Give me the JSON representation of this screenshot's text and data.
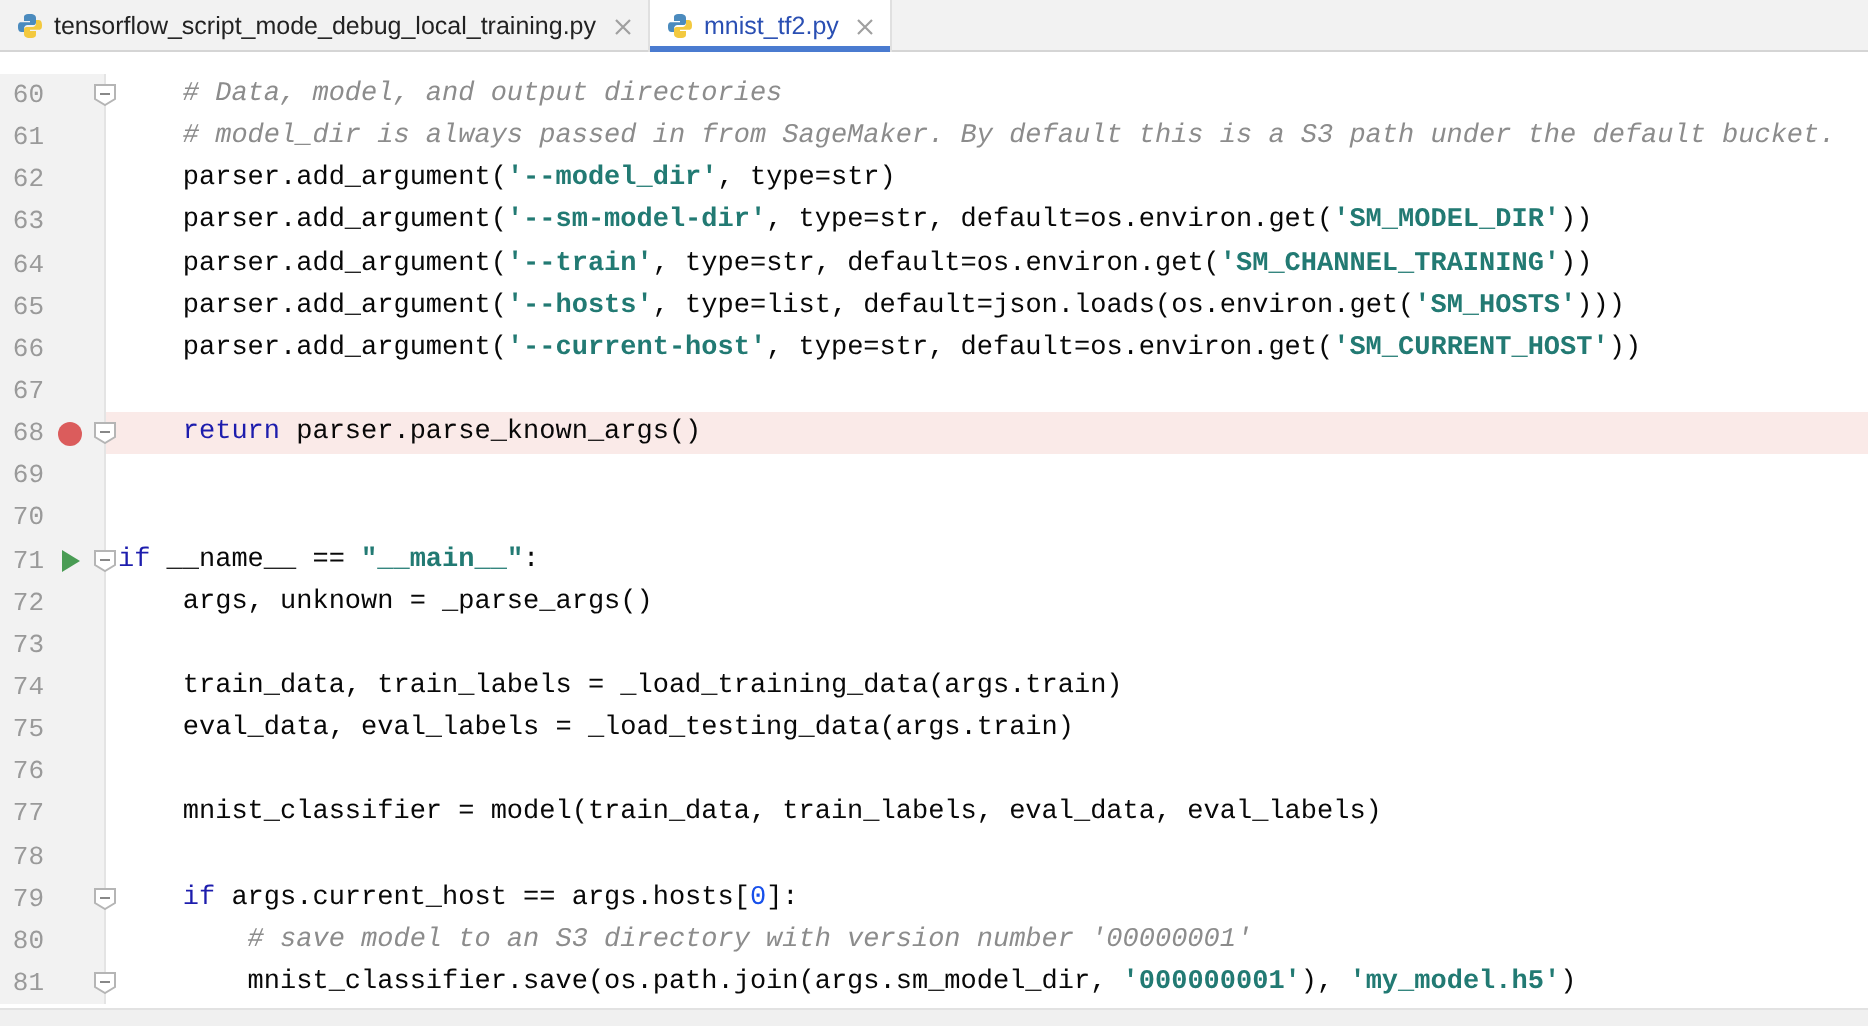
{
  "tabs": [
    {
      "label": "tensorflow_script_mode_debug_local_training.py",
      "selected": false
    },
    {
      "label": "mnist_tf2.py",
      "selected": true
    }
  ],
  "editor": {
    "lines": [
      {
        "number": "60",
        "fold": true,
        "tokens": [
          {
            "kind": "comment",
            "text": "    # Data, model, and output directories"
          }
        ]
      },
      {
        "number": "61",
        "tokens": [
          {
            "kind": "comment",
            "text": "    # model_dir is always passed in from SageMaker. By default this is a S3 path under the default bucket."
          }
        ]
      },
      {
        "number": "62",
        "tokens": [
          {
            "kind": "plain",
            "text": "    parser.add_argument("
          },
          {
            "kind": "string",
            "text": "'--model_dir'"
          },
          {
            "kind": "plain",
            "text": ", type=str)"
          }
        ]
      },
      {
        "number": "63",
        "tokens": [
          {
            "kind": "plain",
            "text": "    parser.add_argument("
          },
          {
            "kind": "string",
            "text": "'--sm-model-dir'"
          },
          {
            "kind": "plain",
            "text": ", type=str, default=os.environ.get("
          },
          {
            "kind": "string",
            "text": "'SM_MODEL_DIR'"
          },
          {
            "kind": "plain",
            "text": "))"
          }
        ]
      },
      {
        "number": "64",
        "tokens": [
          {
            "kind": "plain",
            "text": "    parser.add_argument("
          },
          {
            "kind": "string",
            "text": "'--train'"
          },
          {
            "kind": "plain",
            "text": ", type=str, default=os.environ.get("
          },
          {
            "kind": "string",
            "text": "'SM_CHANNEL_TRAINING'"
          },
          {
            "kind": "plain",
            "text": "))"
          }
        ]
      },
      {
        "number": "65",
        "tokens": [
          {
            "kind": "plain",
            "text": "    parser.add_argument("
          },
          {
            "kind": "string",
            "text": "'--hosts'"
          },
          {
            "kind": "plain",
            "text": ", type=list, default=json.loads(os.environ.get("
          },
          {
            "kind": "string",
            "text": "'SM_HOSTS'"
          },
          {
            "kind": "plain",
            "text": ")))"
          }
        ]
      },
      {
        "number": "66",
        "tokens": [
          {
            "kind": "plain",
            "text": "    parser.add_argument("
          },
          {
            "kind": "string",
            "text": "'--current-host'"
          },
          {
            "kind": "plain",
            "text": ", type=str, default=os.environ.get("
          },
          {
            "kind": "string",
            "text": "'SM_CURRENT_HOST'"
          },
          {
            "kind": "plain",
            "text": "))"
          }
        ]
      },
      {
        "number": "67"
      },
      {
        "number": "68",
        "fold": true,
        "breakpoint": true,
        "highlighted": true,
        "tokens": [
          {
            "kind": "keyword",
            "text": "    return"
          },
          {
            "kind": "plain",
            "text": " parser.parse_known_args()"
          }
        ]
      },
      {
        "number": "69"
      },
      {
        "number": "70"
      },
      {
        "number": "71",
        "fold": true,
        "run": true,
        "tokens": [
          {
            "kind": "keyword",
            "text": "if"
          },
          {
            "kind": "plain",
            "text": " __name__ == "
          },
          {
            "kind": "string",
            "text": "\"__main__\""
          },
          {
            "kind": "plain",
            "text": ":"
          }
        ]
      },
      {
        "number": "72",
        "tokens": [
          {
            "kind": "plain",
            "text": "    args, unknown = _parse_args()"
          }
        ]
      },
      {
        "number": "73"
      },
      {
        "number": "74",
        "tokens": [
          {
            "kind": "plain",
            "text": "    train_data, train_labels = _load_training_data(args.train)"
          }
        ]
      },
      {
        "number": "75",
        "tokens": [
          {
            "kind": "plain",
            "text": "    eval_data, eval_labels = _load_testing_data(args.train)"
          }
        ]
      },
      {
        "number": "76"
      },
      {
        "number": "77",
        "tokens": [
          {
            "kind": "plain",
            "text": "    mnist_classifier = model(train_data, train_labels, eval_data, eval_labels)"
          }
        ]
      },
      {
        "number": "78"
      },
      {
        "number": "79",
        "fold": true,
        "tokens": [
          {
            "kind": "keyword",
            "text": "    if"
          },
          {
            "kind": "plain",
            "text": " args.current_host == args.hosts["
          },
          {
            "kind": "number",
            "text": "0"
          },
          {
            "kind": "plain",
            "text": "]:"
          }
        ]
      },
      {
        "number": "80",
        "tokens": [
          {
            "kind": "comment",
            "text": "        # save model to an S3 directory with version number '00000001'"
          }
        ]
      },
      {
        "number": "81",
        "fold": true,
        "tokens": [
          {
            "kind": "plain",
            "text": "        mnist_classifier.save(os.path.join(args.sm_model_dir, "
          },
          {
            "kind": "string",
            "text": "'000000001'"
          },
          {
            "kind": "plain",
            "text": "), "
          },
          {
            "kind": "string",
            "text": "'my_model.h5'"
          },
          {
            "kind": "plain",
            "text": ")"
          }
        ]
      }
    ]
  }
}
